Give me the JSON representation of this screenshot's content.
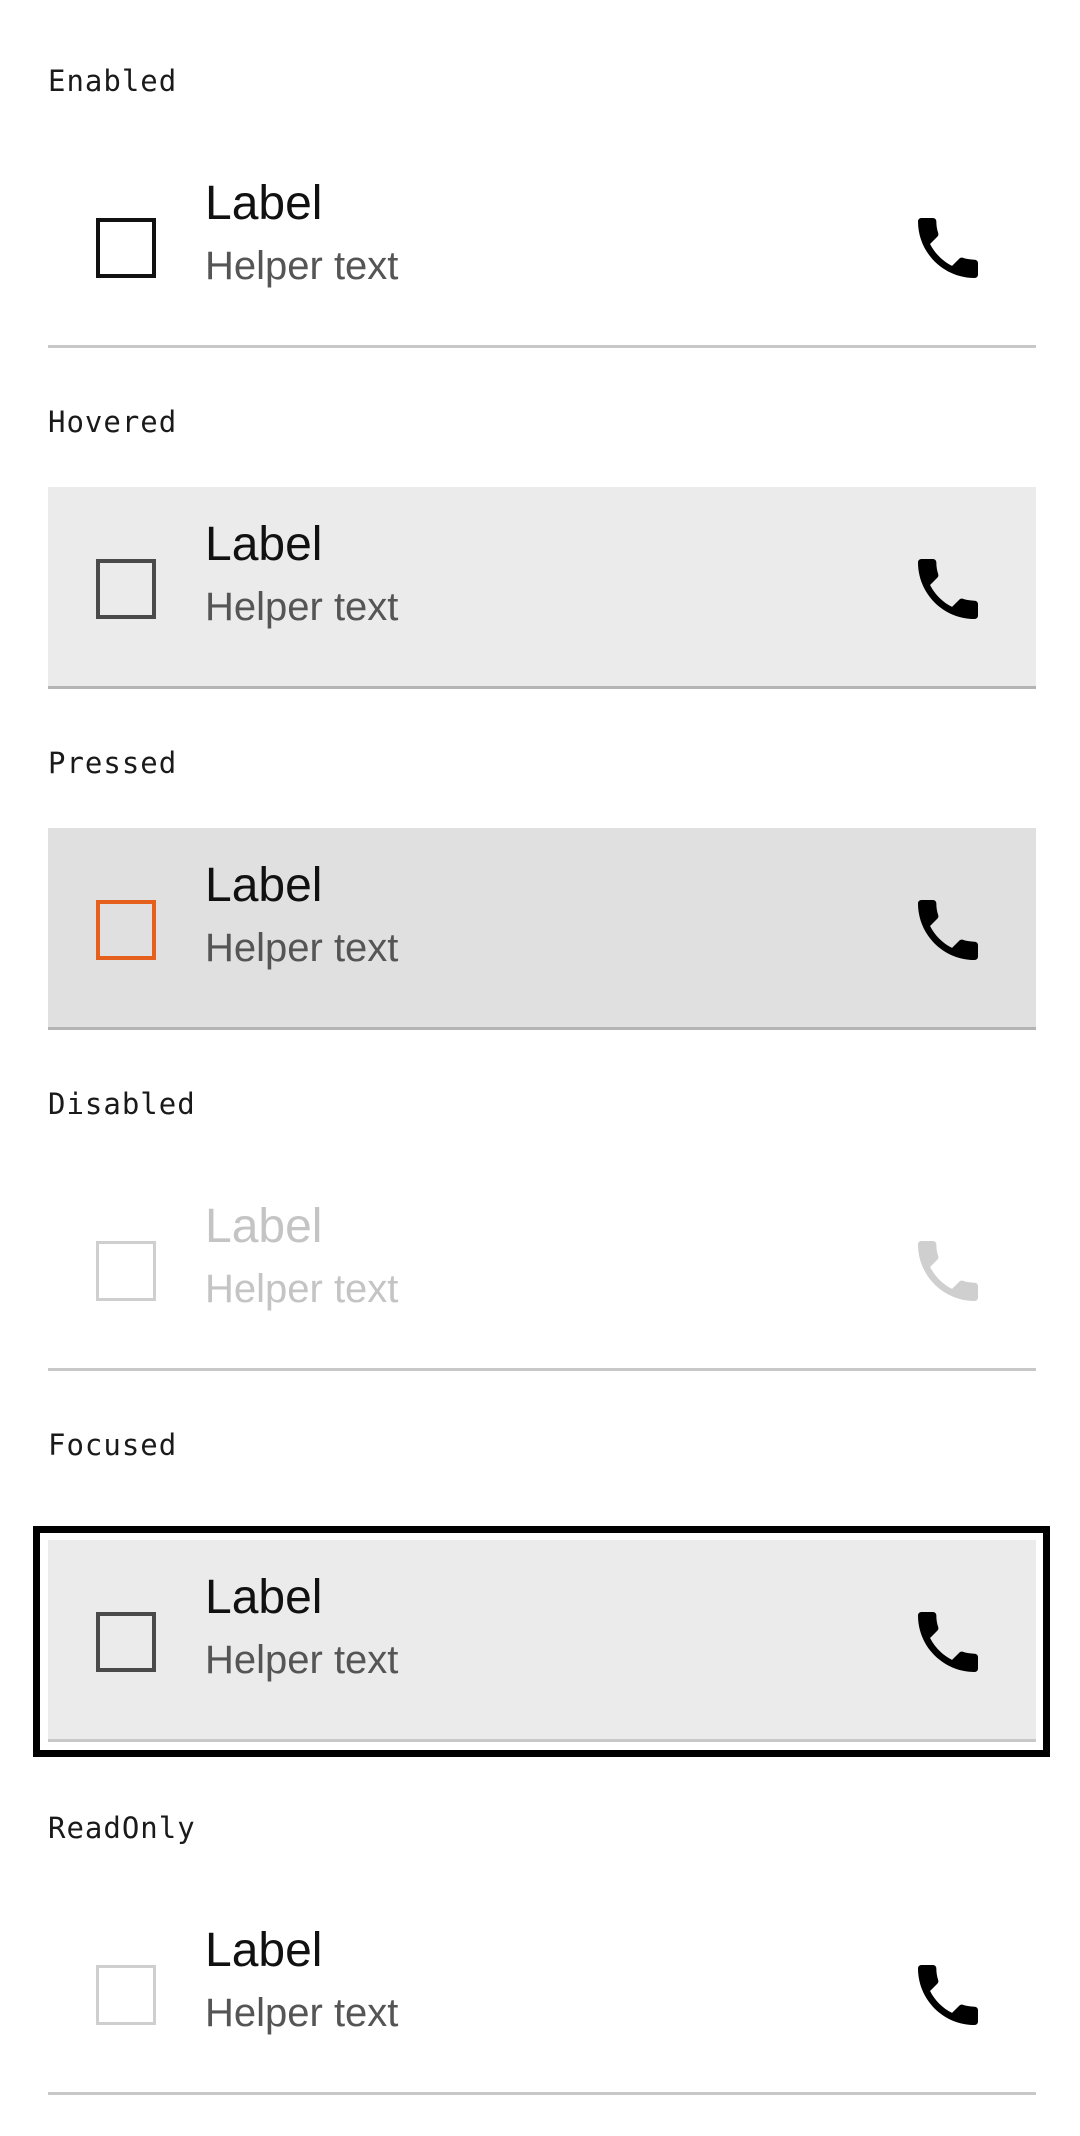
{
  "states": [
    {
      "caption": "Enabled",
      "label": "Label",
      "helper": "Helper text",
      "checked": false,
      "icon": "phone-icon",
      "checkbox_color": "#111111"
    },
    {
      "caption": "Hovered",
      "label": "Label",
      "helper": "Helper text",
      "checked": false,
      "icon": "phone-icon",
      "checkbox_color": "#4a4a4a"
    },
    {
      "caption": "Pressed",
      "label": "Label",
      "helper": "Helper text",
      "checked": false,
      "icon": "phone-icon",
      "checkbox_color": "#e4601c"
    },
    {
      "caption": "Disabled",
      "label": "Label",
      "helper": "Helper text",
      "checked": false,
      "icon": "phone-icon",
      "checkbox_color": "#cfcfcf"
    },
    {
      "caption": "Focused",
      "label": "Label",
      "helper": "Helper text",
      "checked": false,
      "icon": "phone-icon",
      "checkbox_color": "#4a4a4a"
    },
    {
      "caption": "ReadOnly",
      "label": "Label",
      "helper": "Helper text",
      "checked": false,
      "icon": "phone-icon",
      "checkbox_color": "#cfcfcf"
    }
  ],
  "colors": {
    "hover_background": "#ebebeb",
    "pressed_background": "#e0e0e0",
    "focus_ring": "#000000",
    "accent": "#e4601c",
    "divider": "#c8c8c8"
  }
}
